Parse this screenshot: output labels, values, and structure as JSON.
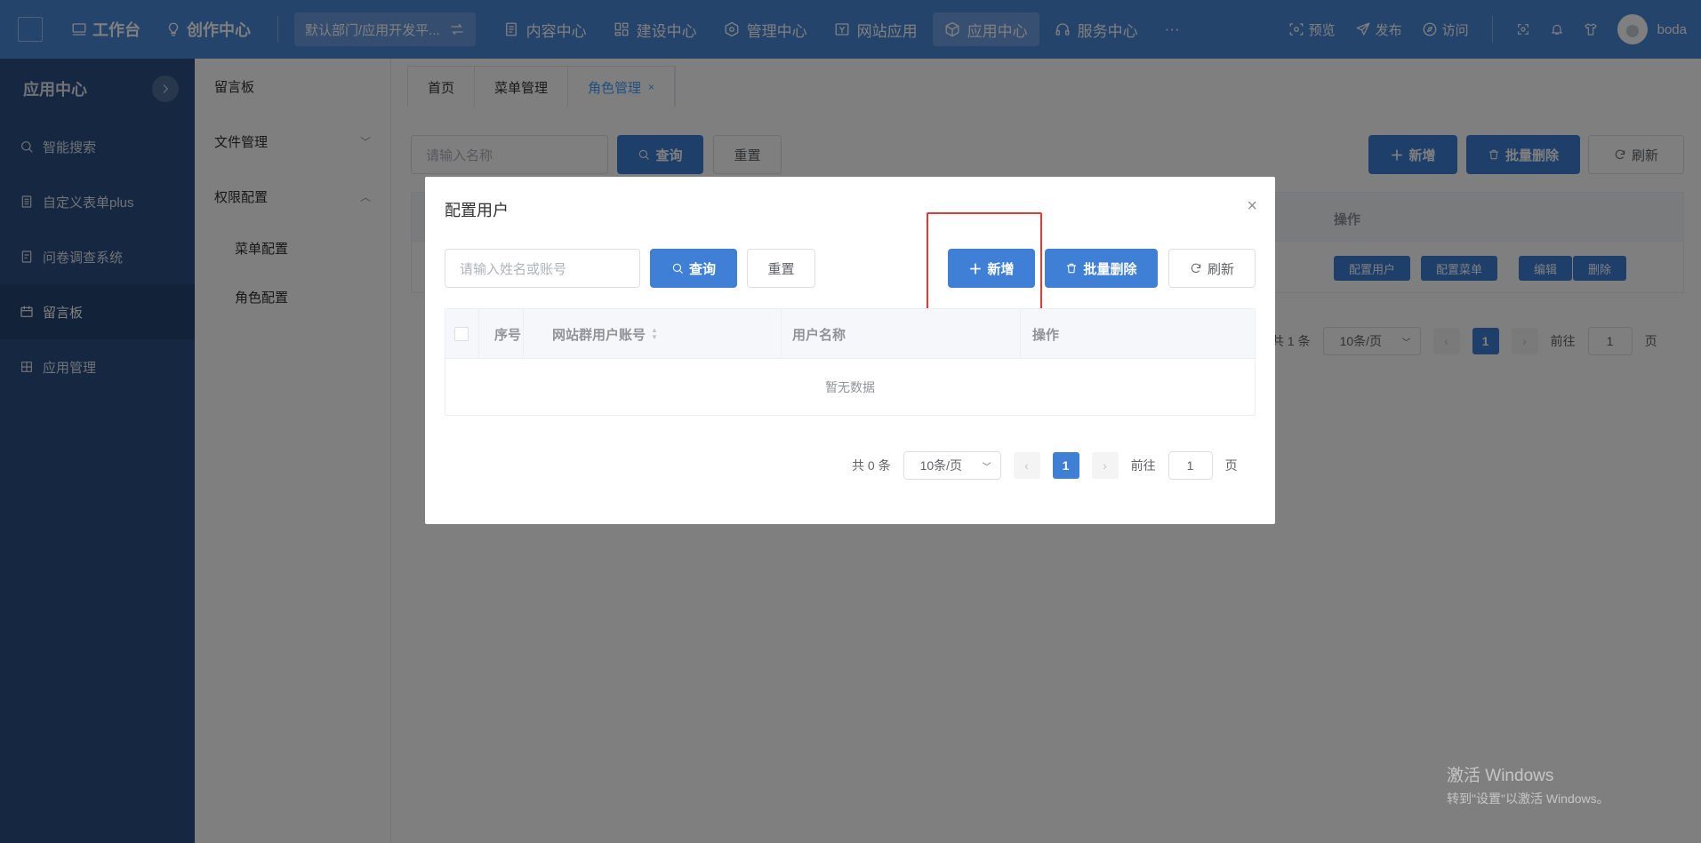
{
  "topbar": {
    "logo_alt": "",
    "main_items": [
      {
        "label": "工作台",
        "icon": "monitor-icon"
      },
      {
        "label": "创作中心",
        "icon": "lightbulb-icon"
      }
    ],
    "dept_label": "默认部门/应用开发平...",
    "nav": [
      {
        "label": "内容中心",
        "icon": "document-icon"
      },
      {
        "label": "建设中心",
        "icon": "layout-icon"
      },
      {
        "label": "管理中心",
        "icon": "hexagon-icon"
      },
      {
        "label": "网站应用",
        "icon": "website-icon"
      },
      {
        "label": "应用中心",
        "icon": "cube-icon"
      },
      {
        "label": "服务中心",
        "icon": "headset-icon"
      },
      {
        "label": "···",
        "icon": "more-icon"
      }
    ],
    "right": [
      {
        "label": "预览",
        "icon": "eye-icon"
      },
      {
        "label": "发布",
        "icon": "send-icon"
      },
      {
        "label": "访问",
        "icon": "compass-icon"
      }
    ],
    "username": "boda"
  },
  "sidebar": {
    "title": "应用中心",
    "items": [
      {
        "label": "智能搜索",
        "icon": "search-icon"
      },
      {
        "label": "自定义表单plus",
        "icon": "form-icon"
      },
      {
        "label": "问卷调查系统",
        "icon": "survey-icon"
      },
      {
        "label": "留言板",
        "icon": "message-icon"
      },
      {
        "label": "应用管理",
        "icon": "grid-icon"
      }
    ]
  },
  "submenu": {
    "items": [
      "留言板",
      "文件管理",
      "权限配置"
    ],
    "children": [
      "菜单配置",
      "角色配置"
    ]
  },
  "tabs": [
    {
      "label": "首页"
    },
    {
      "label": "菜单管理"
    },
    {
      "label": "角色管理",
      "close": "×"
    }
  ],
  "background": {
    "search_placeholder": "请输入名称",
    "query": "查询",
    "reset": "重置",
    "add": "新增",
    "batch_delete": "批量删除",
    "refresh": "刷新",
    "ops_header": "操作",
    "row_actions": [
      "配置用户",
      "配置菜单",
      "编辑",
      "删除"
    ],
    "pagination": {
      "total": "共 1 条",
      "page_size": "10条/页",
      "current": "1",
      "goto_label": "前往",
      "goto_value": "1",
      "page_unit": "页"
    }
  },
  "dialog": {
    "title": "配置用户",
    "close": "×",
    "search_placeholder": "请输入姓名或账号",
    "query": "查询",
    "reset": "重置",
    "add": "新增",
    "batch_delete": "批量删除",
    "refresh": "刷新",
    "columns": [
      "序号",
      "网站群用户账号",
      "用户名称",
      "操作"
    ],
    "empty_text": "暂无数据",
    "pagination": {
      "total": "共 0 条",
      "page_size": "10条/页",
      "current": "1",
      "goto_label": "前往",
      "goto_value": "1",
      "page_unit": "页"
    }
  },
  "watermark": {
    "line1": "激活 Windows",
    "line2": "转到\"设置\"以激活 Windows。"
  },
  "colors": {
    "topbar": "#4a88d9",
    "sidebar": "#2b4f82",
    "primary": "#3f7fd6",
    "highlight": "#e53935"
  }
}
